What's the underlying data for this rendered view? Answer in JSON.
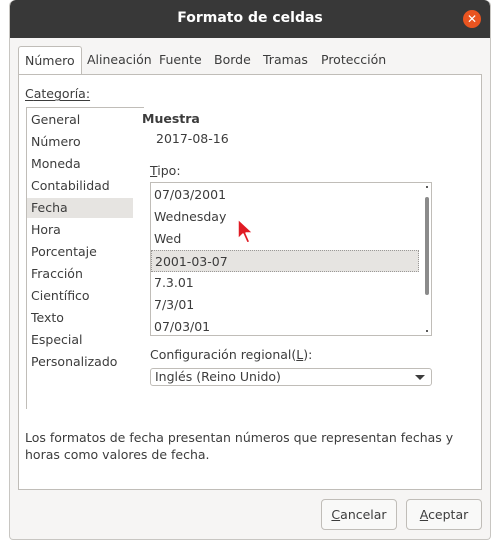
{
  "window": {
    "title": "Formato de celdas"
  },
  "tabs": [
    {
      "label": "Número"
    },
    {
      "label": "Alineación"
    },
    {
      "label": "Fuente"
    },
    {
      "label": "Borde"
    },
    {
      "label": "Tramas"
    },
    {
      "label": "Protección"
    }
  ],
  "category": {
    "label_first": "C",
    "label_rest": "ategoría:",
    "items": [
      {
        "label": "General"
      },
      {
        "label": "Número"
      },
      {
        "label": "Moneda"
      },
      {
        "label": "Contabilidad"
      },
      {
        "label": "Fecha"
      },
      {
        "label": "Hora"
      },
      {
        "label": "Porcentaje"
      },
      {
        "label": "Fracción"
      },
      {
        "label": "Científico"
      },
      {
        "label": "Texto"
      },
      {
        "label": "Especial"
      },
      {
        "label": "Personalizado"
      }
    ],
    "selected": "Fecha"
  },
  "sample": {
    "label": "Muestra",
    "value": "2017-08-16"
  },
  "format_type": {
    "label_first": "T",
    "label_rest": "ipo:",
    "items": [
      {
        "label": "07/03/2001"
      },
      {
        "label": "Wednesday"
      },
      {
        "label": "Wed"
      },
      {
        "label": "2001-03-07"
      },
      {
        "label": "7.3.01"
      },
      {
        "label": "7/3/01"
      },
      {
        "label": "07/03/01"
      }
    ],
    "selected": "2001-03-07"
  },
  "region": {
    "label_before": "Configuración regional(",
    "label_key": "L",
    "label_after": "):",
    "value": "Inglés (Reino Unido)"
  },
  "description": "Los formatos de fecha presentan números que representan fechas y horas como valores de fecha.",
  "buttons": {
    "cancel_first": "C",
    "cancel_rest": "ancelar",
    "ok_first": "A",
    "ok_rest": "ceptar"
  },
  "colors": {
    "titlebar": "#383838",
    "close": "#e95420",
    "selection": "#e6e4e1",
    "cursor": "#e01b24"
  },
  "icons": {
    "close": "close-icon",
    "dropdown": "chevron-down-icon",
    "pointer": "mouse-pointer-icon"
  }
}
